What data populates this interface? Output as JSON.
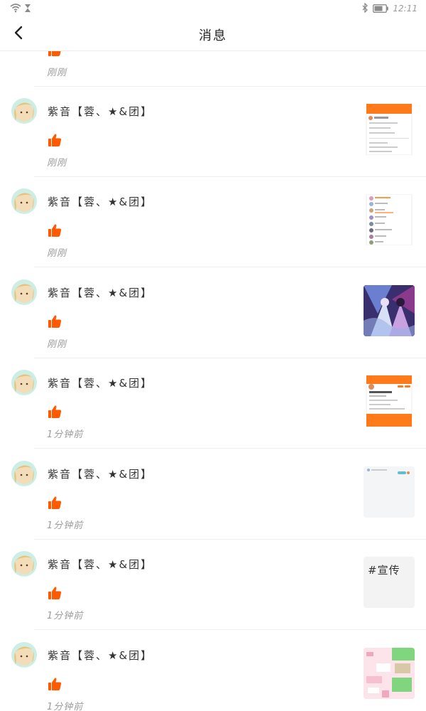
{
  "status_bar": {
    "time": "12:11"
  },
  "header": {
    "title": "消息"
  },
  "messages": [
    {
      "name": "",
      "time": "刚刚",
      "thumbnail": "mini-screenshot-partial"
    },
    {
      "name": "紫音【蓉、★&团】",
      "time": "刚刚",
      "thumbnail": "mini-screenshot-orange-post"
    },
    {
      "name": "紫音【蓉、★&团】",
      "time": "刚刚",
      "thumbnail": "mini-screenshot-list"
    },
    {
      "name": "紫音【蓉、★&团】",
      "time": "刚刚",
      "thumbnail": "anime-artwork"
    },
    {
      "name": "紫音【蓉、★&团】",
      "time": "1分钟前",
      "thumbnail": "mini-screenshot-orange-post"
    },
    {
      "name": "紫音【蓉、★&团】",
      "time": "1分钟前",
      "thumbnail": "mini-screenshot-blank"
    },
    {
      "name": "紫音【蓉、★&团】",
      "time": "1分钟前",
      "thumbnail_text": "#宣传"
    },
    {
      "name": "紫音【蓉、★&团】",
      "time": "1分钟前",
      "thumbnail": "pink-green-collage"
    }
  ],
  "icons": {
    "back": "chevron-left-icon",
    "like": "thumbs-up-icon",
    "wifi": "wifi-icon",
    "hourglass": "hourglass-icon",
    "bluetooth": "bluetooth-icon",
    "battery": "battery-icon"
  },
  "colors": {
    "like": "#ff5a00",
    "accent_orange": "#ff7a1a"
  }
}
